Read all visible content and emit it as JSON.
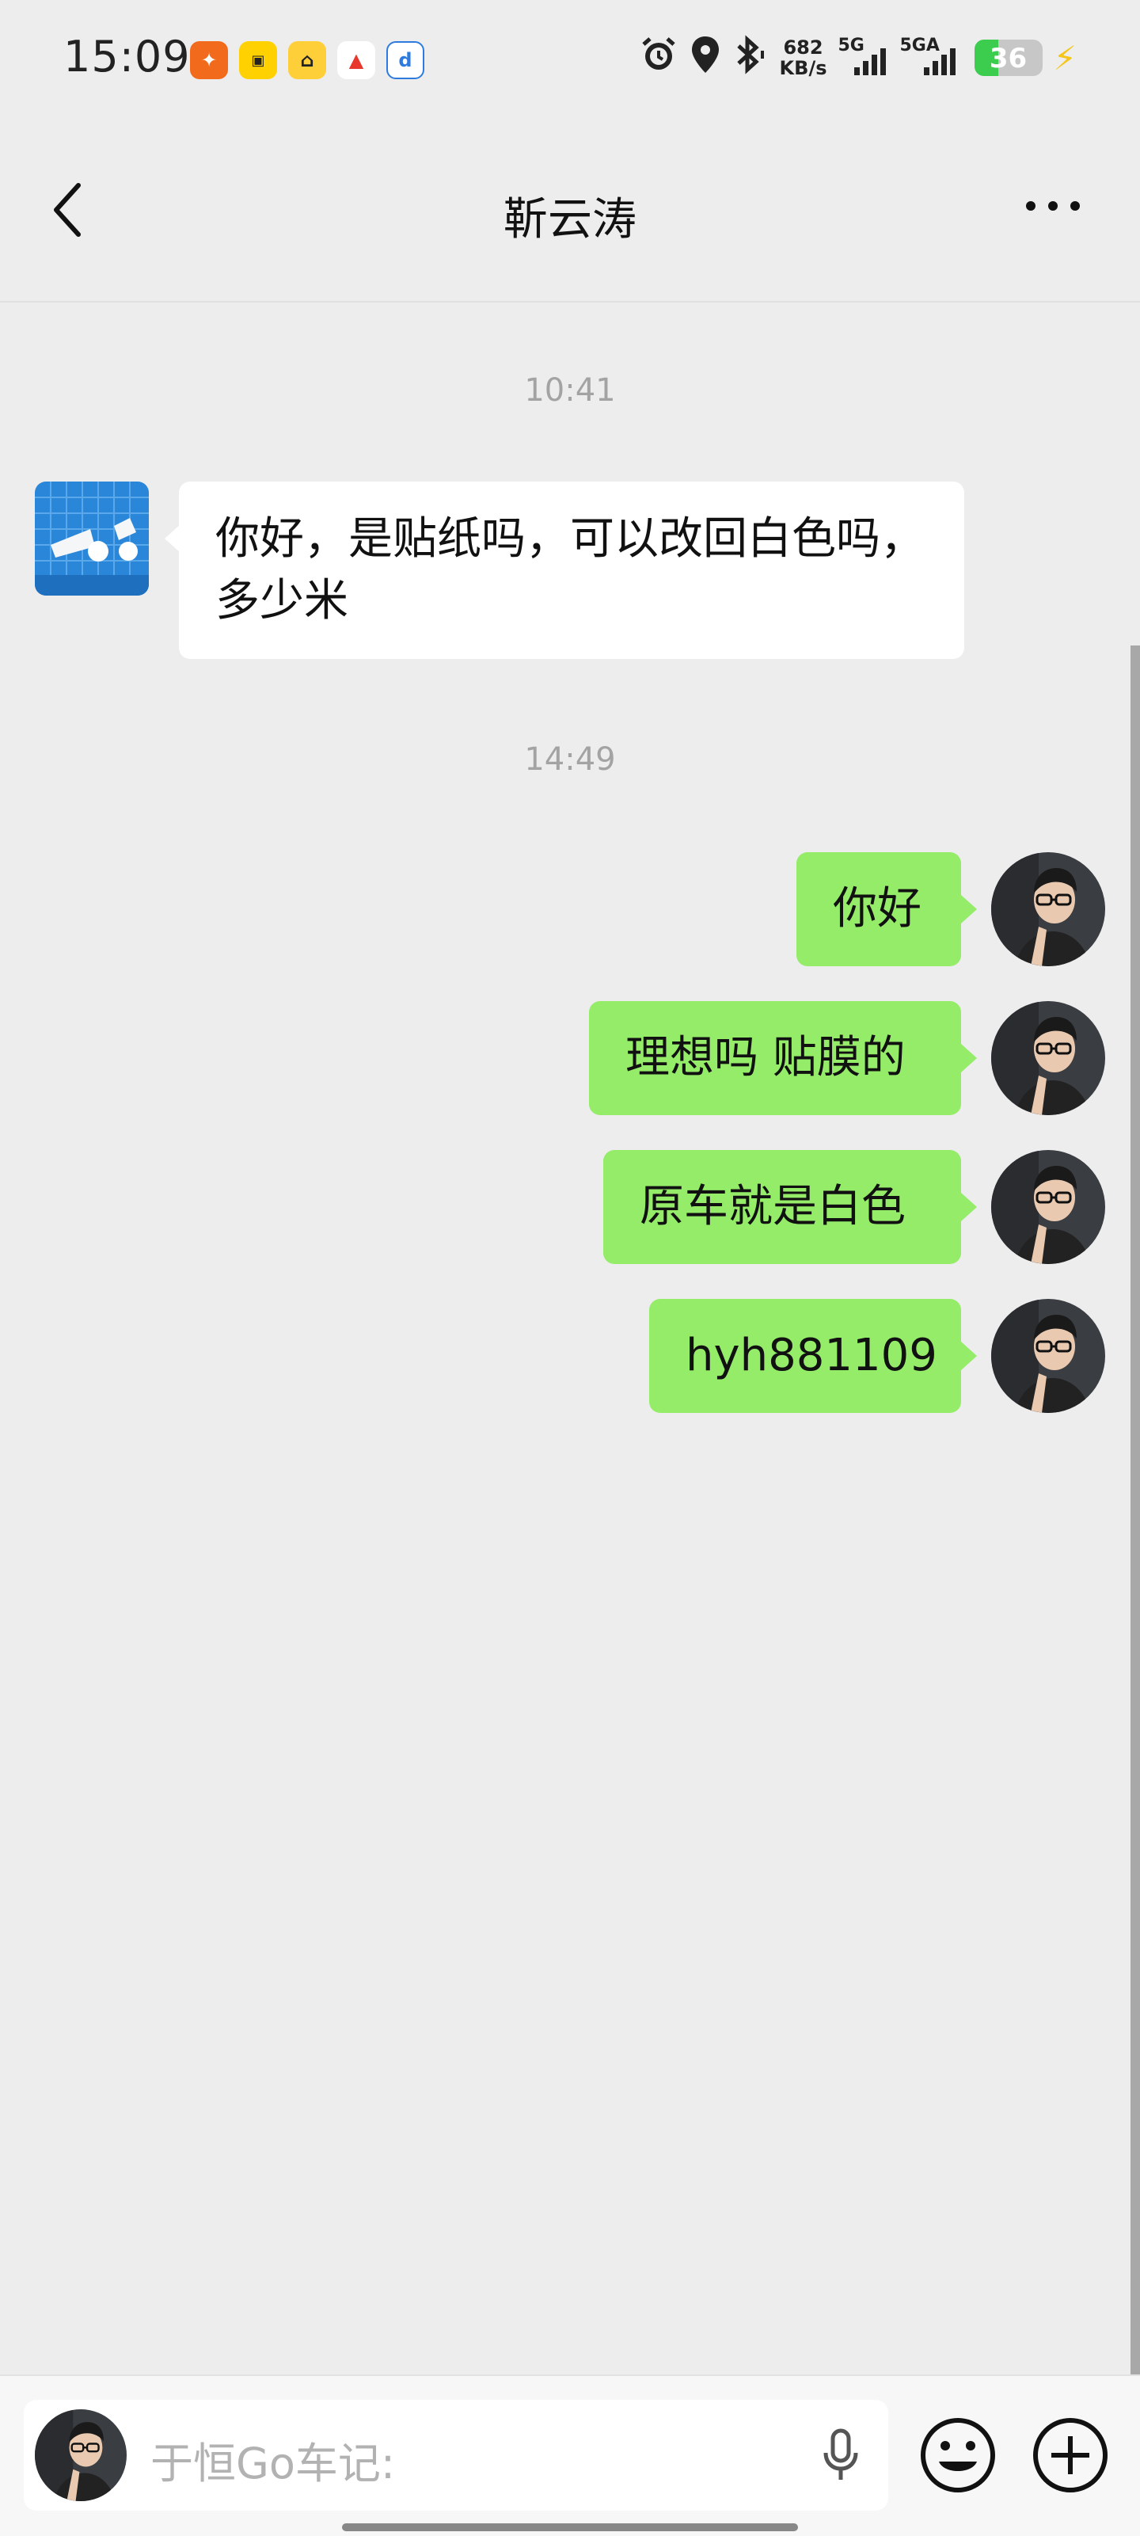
{
  "status_bar": {
    "time": "15:09",
    "net_speed_value": "682",
    "net_speed_unit": "KB/s",
    "sim1_label": "5G",
    "sim2_label": "5GA",
    "battery_level": "36",
    "battery_fraction": 0.36,
    "app_icons": [
      "kuaishou-icon",
      "meituan-icon",
      "car-app-icon",
      "red-app-icon",
      "blue-app-icon"
    ]
  },
  "header": {
    "title": "靳云涛"
  },
  "messages": [
    {
      "type": "time",
      "text": "10:41"
    },
    {
      "type": "received",
      "text": "你好，是贴纸吗，可以改回白色吗，多少米"
    },
    {
      "type": "time",
      "text": "14:49"
    },
    {
      "type": "sent",
      "text": "你好"
    },
    {
      "type": "sent",
      "text": "理想吗 贴膜的"
    },
    {
      "type": "sent",
      "text": "原车就是白色"
    },
    {
      "type": "sent",
      "text": "hyh881109"
    }
  ],
  "input": {
    "placeholder": "于恒Go车记:"
  },
  "colors": {
    "background": "#ededed",
    "sent_bubble": "#95ec69",
    "received_bubble": "#ffffff",
    "timestamp": "#a3a3a3"
  }
}
